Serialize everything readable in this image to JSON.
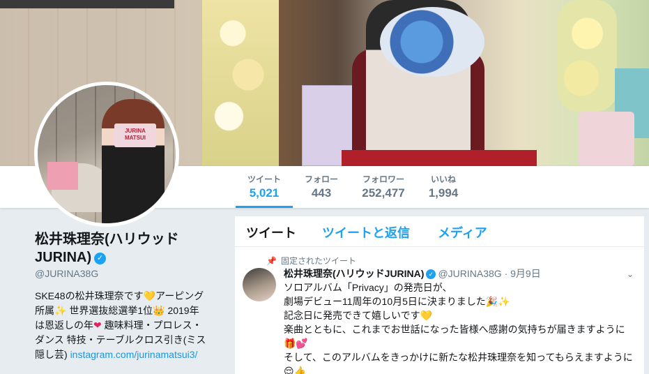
{
  "profile": {
    "name_line1": "松井珠理奈(ハリウッド",
    "name_line2": "JURINA)",
    "verified": "✓",
    "handle": "@JURINA38G",
    "bio_1": "SKE48の松井珠理奈です",
    "bio_2": "アーピング所属",
    "bio_3": " 世界選抜総選挙1位",
    "bio_4": " 2019年は恩返しの年",
    "bio_5": " 趣味料理・プロレス・ダンス 特技・テーブルクロス引き(ミス隠し芸) ",
    "bio_link": "instagram.com/jurinamatsui3/",
    "box_text": "JURINA MATSUI"
  },
  "stats": [
    {
      "label": "ツイート",
      "value": "5,021"
    },
    {
      "label": "フォロー",
      "value": "443"
    },
    {
      "label": "フォロワー",
      "value": "252,477"
    },
    {
      "label": "いいね",
      "value": "1,994"
    }
  ],
  "tabs": [
    "ツイート",
    "ツイートと返信",
    "メディア"
  ],
  "tweet": {
    "pinned_label": "固定されたツイート",
    "name": "松井珠理奈(ハリウッドJURINA)",
    "handle": "@JURINA38G",
    "date": "· 9月9日",
    "lines": [
      "ソロアルバム「Privacy」の発売日が、",
      "劇場デビュー11周年の10月5日に決まりました🎉✨",
      "記念日に発売できて嬉しいです💛",
      "楽曲とともに、これまでお世話になった皆様へ感謝の気持ちが届きますように",
      "🎁💕",
      "そして、このアルバムをきっかけに新たな松井珠理奈を知ってもらえますように",
      "😌👍"
    ]
  },
  "colors": {
    "accent": "#1da1f2",
    "background": "#e6ecf0"
  }
}
